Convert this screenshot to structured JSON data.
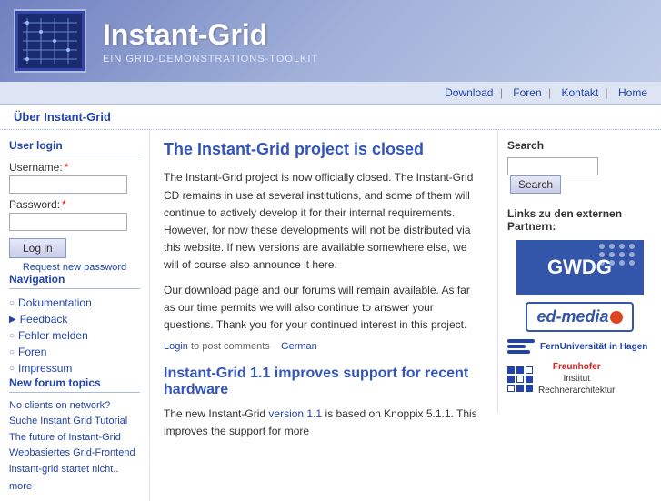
{
  "header": {
    "title": "Instant-Grid",
    "subtitle": "Ein Grid-Demonstrations-Toolkit"
  },
  "topnav": {
    "items": [
      "Download",
      "Foren",
      "Kontakt",
      "Home"
    ]
  },
  "breadcrumb": "Über Instant-Grid",
  "sidebar": {
    "login_title": "User login",
    "username_label": "Username:",
    "password_label": "Password:",
    "login_button": "Log in",
    "request_password": "Request new password",
    "nav_title": "Navigation",
    "nav_items": [
      {
        "label": "Dokumentation",
        "bullet": "○"
      },
      {
        "label": "Feedback",
        "bullet": "▶"
      },
      {
        "label": "Fehler melden",
        "bullet": "○"
      },
      {
        "label": "Foren",
        "bullet": "○"
      },
      {
        "label": "Impressum",
        "bullet": "○"
      }
    ],
    "forum_title": "New forum topics",
    "forum_items": [
      "No clients on network?",
      "Suche Instant Grid Tutorial",
      "The future of Instant-Grid",
      "Webbasiertes Grid-Frontend",
      "instant-grid startet nicht.."
    ],
    "more_label": "more"
  },
  "main": {
    "article1": {
      "title": "The Instant-Grid project is closed",
      "body1": "The Instant-Grid project is now officially closed. The Instant-Grid CD remains in use at several institutions, and some of them will continue to actively develop it for their internal requirements. However, for now these developments will not be distributed via this website. If new versions are available somewhere else, we will of course also announce it here.",
      "body2": "Our download page and our forums will remain available. As far as our time permits we will also continue to answer your questions. Thank you for your continued interest in this project.",
      "footer_login": "Login",
      "footer_text": "to post comments",
      "footer_german": "German"
    },
    "article2": {
      "title": "Instant-Grid 1.1 improves support for recent hardware",
      "body1": "The new Instant-Grid",
      "version_link": "version 1.1",
      "body2": "is based on Knoppix 5.1.1. This improves the support for more"
    }
  },
  "right": {
    "search_title": "Search",
    "search_placeholder": "",
    "search_button": "Search",
    "partners_title": "Links zu den externen Partnern:",
    "partners": [
      {
        "name": "GWDG"
      },
      {
        "name": "ed-media"
      },
      {
        "name": "FernUniversität in Hagen"
      },
      {
        "name": "Fraunhofer Institut Rechnerarchitektur"
      }
    ]
  }
}
